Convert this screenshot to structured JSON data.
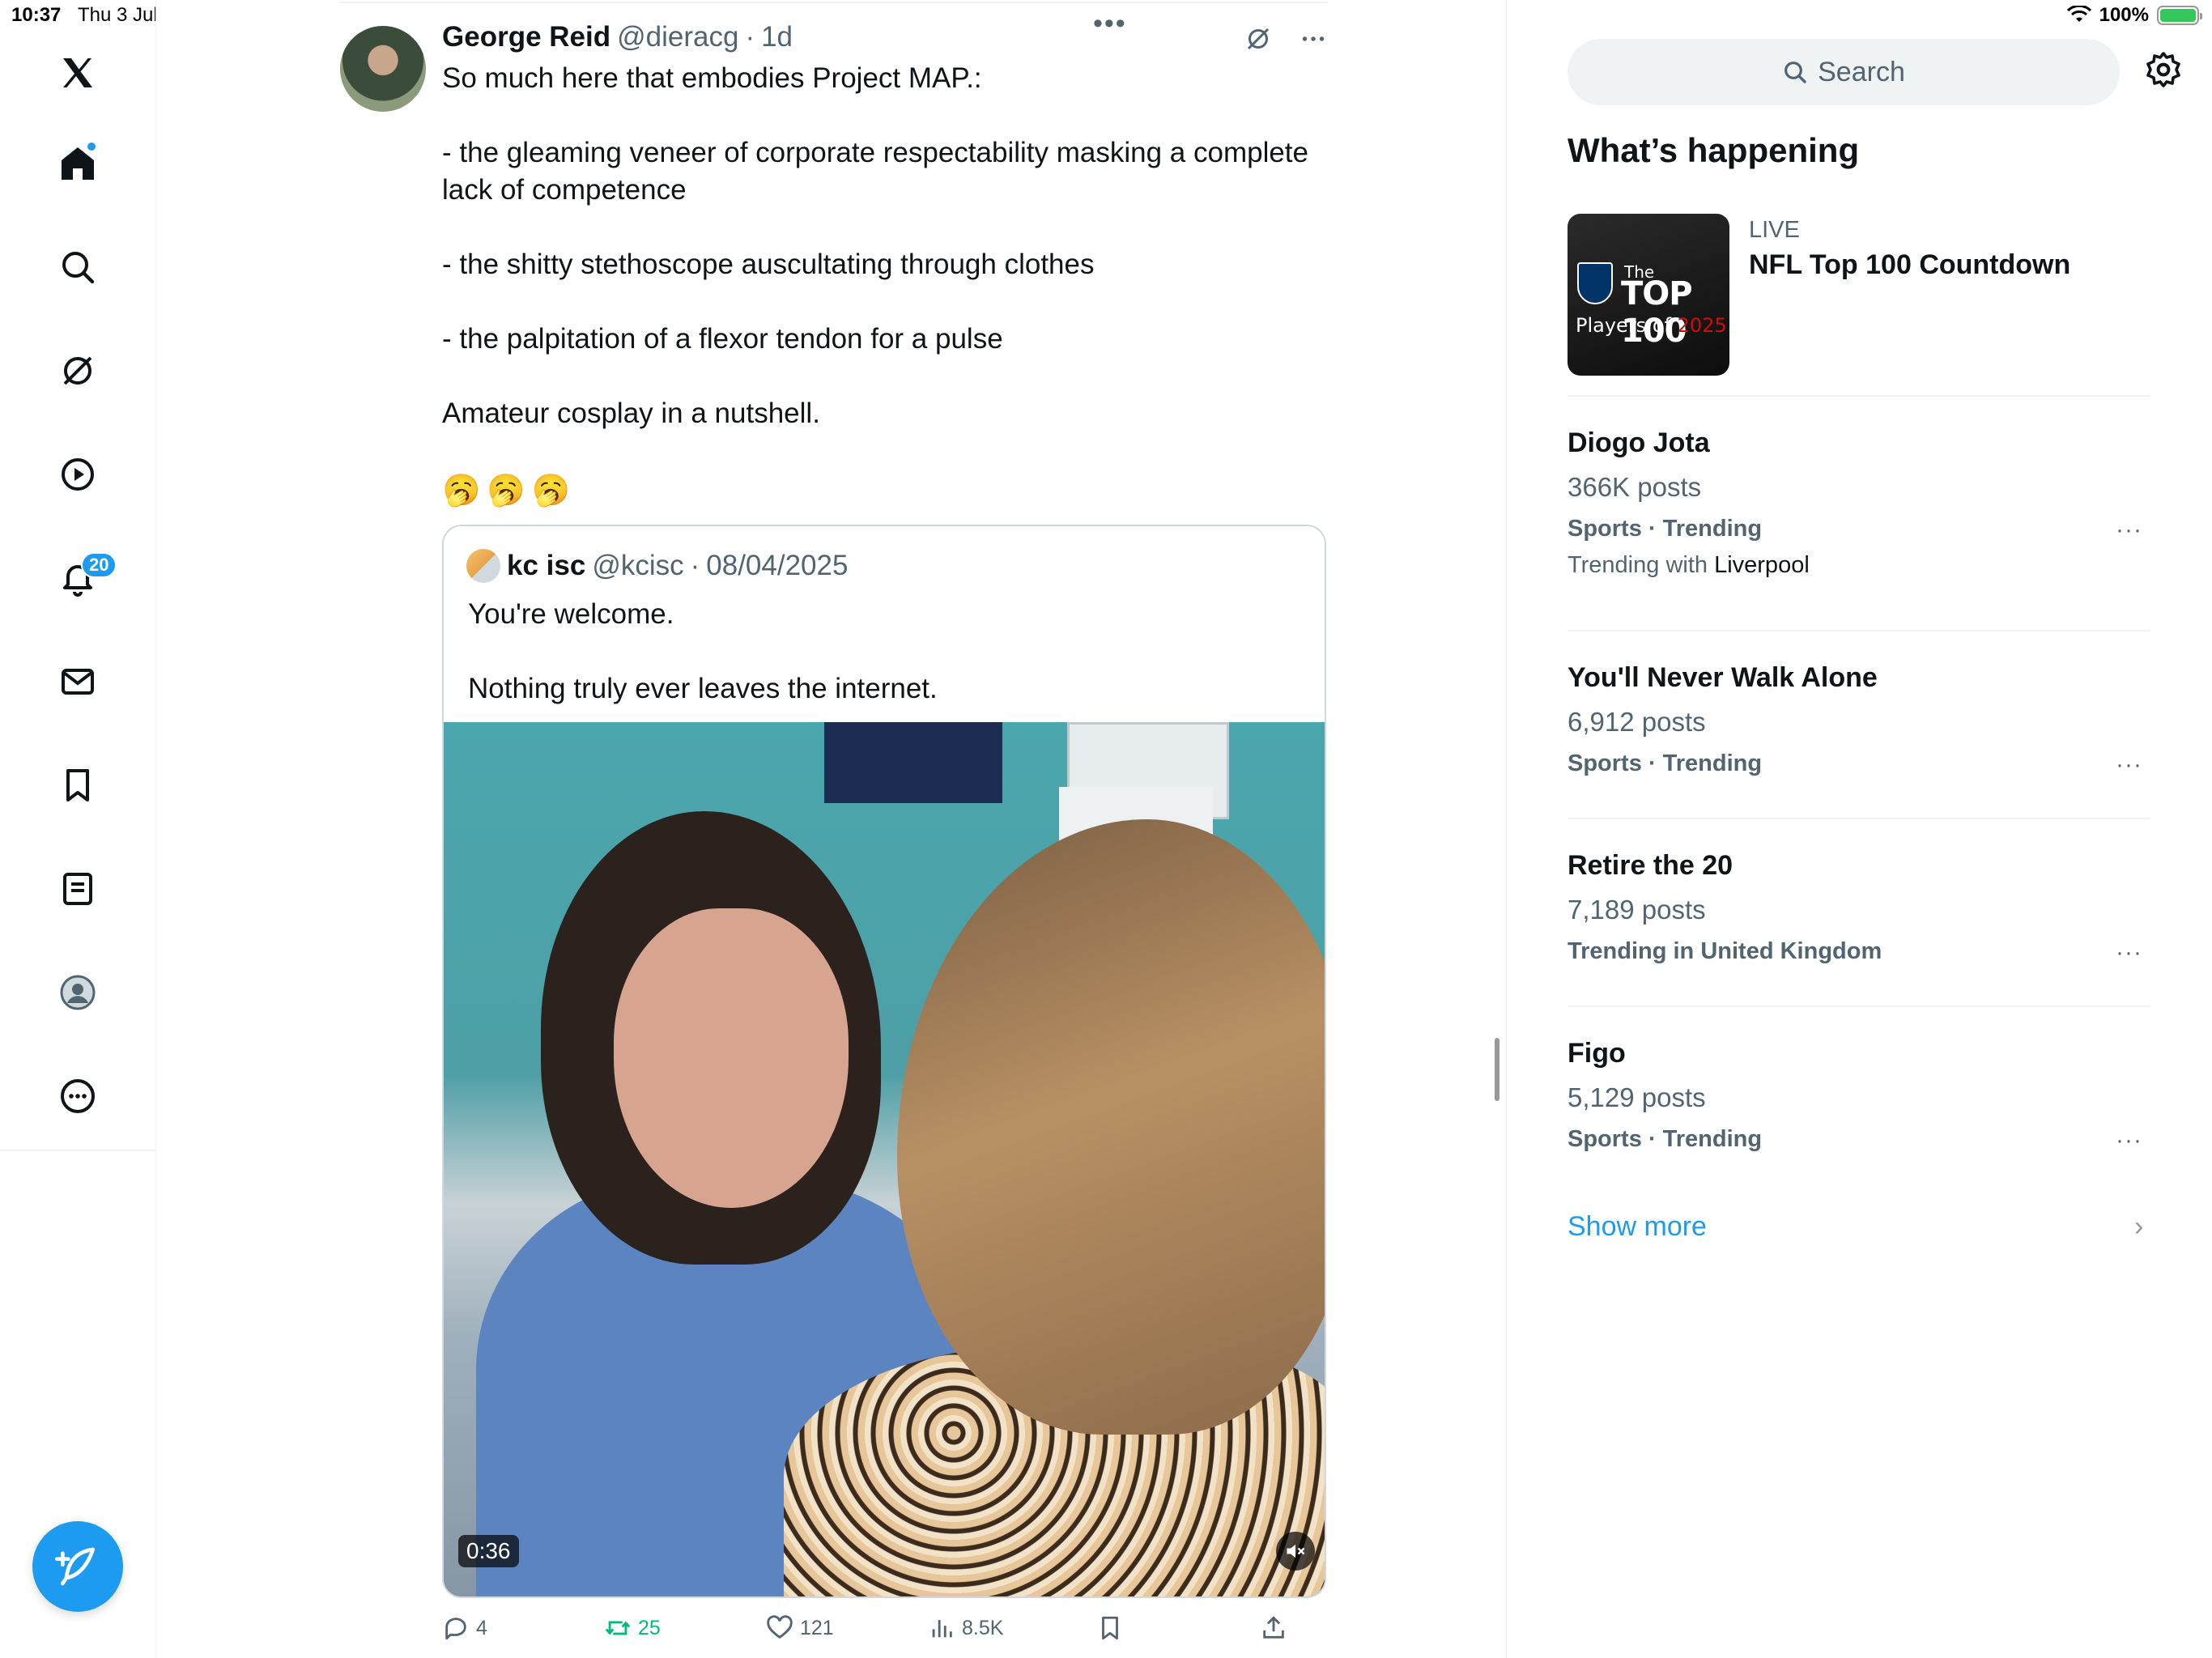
{
  "status_bar": {
    "time": "10:37",
    "date": "Thu 3 Jul",
    "battery": "100%",
    "battery_level": 1.0
  },
  "nav": {
    "items": [
      "x-logo",
      "home",
      "search",
      "grok",
      "video",
      "notifications",
      "messages",
      "bookmarks",
      "lists",
      "profile",
      "more"
    ],
    "notifications_badge": "20",
    "compose_label": "Post"
  },
  "post": {
    "author_name": "George Reid",
    "author_handle": "@dieracg",
    "separator": "·",
    "time": "1d",
    "text": {
      "l1": "So much here that embodies Project MAP.:",
      "l2": "- the gleaming veneer of corporate respectability masking a complete",
      "l3": "lack of competence",
      "l4": "- the shitty stethoscope auscultating through clothes",
      "l5": "- the palpitation of a flexor tendon for a pulse",
      "l6": "Amateur cosplay in a nutshell."
    },
    "emojis": "🥱🥱🥱",
    "quote": {
      "name": "kc isc",
      "handle": "@kcisc",
      "separator": "·",
      "date": "08/04/2025",
      "text1": "You're welcome.",
      "text2": "Nothing truly ever leaves the internet.",
      "video_duration": "0:36"
    },
    "actions": {
      "replies": "4",
      "reposts": "25",
      "likes": "121",
      "views": "8.5K"
    }
  },
  "sidebar": {
    "search_placeholder": "Search",
    "section_title": "What’s happening",
    "live": {
      "label": "LIVE",
      "title": "NFL Top 100 Countdown",
      "thumb_the": "The",
      "thumb_top": "TOP 100",
      "thumb_players": "Players of",
      "thumb_year": "2025"
    },
    "trends": [
      {
        "name": "Diogo Jota",
        "posts": "366K posts",
        "category": "Sports · Trending",
        "with_prefix": "Trending with",
        "with_value": "Liverpool"
      },
      {
        "name": "You'll Never Walk Alone",
        "posts": "6,912 posts",
        "category": "Sports · Trending"
      },
      {
        "name": "Retire the 20",
        "posts": "7,189 posts",
        "category": "Trending in United Kingdom"
      },
      {
        "name": "Figo",
        "posts": "5,129 posts",
        "category": "Sports · Trending"
      }
    ],
    "more_dots": "···",
    "show_more": "Show more",
    "show_more_chevron": "›"
  },
  "colors": {
    "accent": "#1d9bf0",
    "text": "#0f1419",
    "muted": "#536471",
    "repost": "#00ba7c",
    "border": "#eff3f4"
  }
}
